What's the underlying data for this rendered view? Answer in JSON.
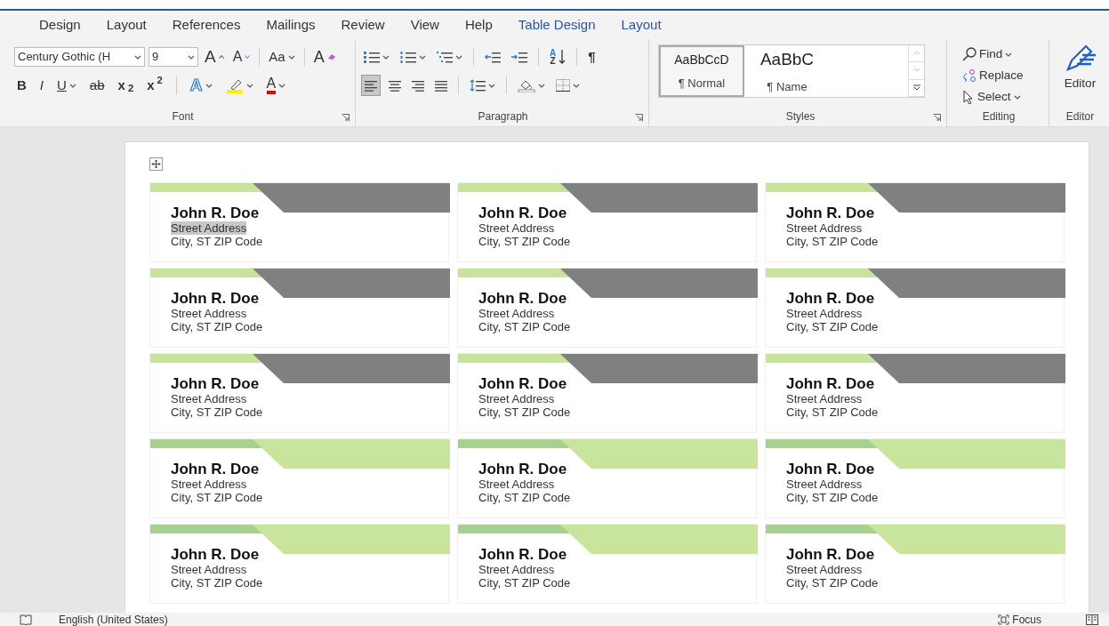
{
  "tabs": [
    {
      "label": "Design",
      "kind": "normal"
    },
    {
      "label": "Layout",
      "kind": "normal"
    },
    {
      "label": "References",
      "kind": "normal"
    },
    {
      "label": "Mailings",
      "kind": "normal"
    },
    {
      "label": "Review",
      "kind": "normal"
    },
    {
      "label": "View",
      "kind": "normal"
    },
    {
      "label": "Help",
      "kind": "normal"
    },
    {
      "label": "Table Design",
      "kind": "contextual"
    },
    {
      "label": "Layout",
      "kind": "contextual"
    }
  ],
  "font": {
    "label": "Font",
    "font_name": "Century Gothic (H",
    "font_size": "9",
    "grow": "A",
    "shrink": "A",
    "change_case": "Aa",
    "clear": "A",
    "format_buttons": [
      {
        "label": "B",
        "kind": "bold"
      },
      {
        "label": "I",
        "kind": "italic"
      },
      {
        "label": "U",
        "kind": "underline"
      },
      {
        "label": "ab",
        "kind": "strike"
      },
      {
        "label": "x$_{2}$",
        "kind": "script"
      },
      {
        "label": "x$^{2}$",
        "kind": "script"
      }
    ],
    "effects": "A",
    "font_color": "A"
  },
  "paragraph": {
    "label": "Paragraph",
    "sort_top": "A",
    "sort_bottom": "Z",
    "pilcrow": "¶",
    "alignments": [
      {
        "kind": "left",
        "selected": true
      },
      {
        "kind": "center",
        "selected": false
      },
      {
        "kind": "right",
        "selected": false
      },
      {
        "kind": "justify",
        "selected": false
      }
    ]
  },
  "styles": {
    "label": "Styles",
    "items": [
      {
        "preview": "AaBbCcD",
        "name": "¶ Normal",
        "selected": true
      },
      {
        "preview": "AaBbC",
        "name": "¶ Name",
        "selected": false
      }
    ]
  },
  "editing": {
    "label": "Editing",
    "find": "Find",
    "replace": "Replace",
    "select": "Select"
  },
  "editor": {
    "button": "Editor",
    "label": "Editor"
  },
  "labels": [
    {
      "name": "John R. Doe",
      "street": "Street Address",
      "city": "City, ST ZIP Code",
      "kind": "gray",
      "street_selected": true
    },
    {
      "name": "John R. Doe",
      "street": "Street Address",
      "city": "City, ST ZIP Code",
      "kind": "gray",
      "street_selected": false
    },
    {
      "name": "John R. Doe",
      "street": "Street Address",
      "city": "City, ST ZIP Code",
      "kind": "gray",
      "street_selected": false
    },
    {
      "name": "John R. Doe",
      "street": "Street Address",
      "city": "City, ST ZIP Code",
      "kind": "gray",
      "street_selected": false
    },
    {
      "name": "John R. Doe",
      "street": "Street Address",
      "city": "City, ST ZIP Code",
      "kind": "gray",
      "street_selected": false
    },
    {
      "name": "John R. Doe",
      "street": "Street Address",
      "city": "City, ST ZIP Code",
      "kind": "gray",
      "street_selected": false
    },
    {
      "name": "John R. Doe",
      "street": "Street Address",
      "city": "City, ST ZIP Code",
      "kind": "gray",
      "street_selected": false
    },
    {
      "name": "John R. Doe",
      "street": "Street Address",
      "city": "City, ST ZIP Code",
      "kind": "gray",
      "street_selected": false
    },
    {
      "name": "John R. Doe",
      "street": "Street Address",
      "city": "City, ST ZIP Code",
      "kind": "gray",
      "street_selected": false
    },
    {
      "name": "John R. Doe",
      "street": "Street Address",
      "city": "City, ST ZIP Code",
      "kind": "green",
      "street_selected": false
    },
    {
      "name": "John R. Doe",
      "street": "Street Address",
      "city": "City, ST ZIP Code",
      "kind": "green",
      "street_selected": false
    },
    {
      "name": "John R. Doe",
      "street": "Street Address",
      "city": "City, ST ZIP Code",
      "kind": "green",
      "street_selected": false
    },
    {
      "name": "John R. Doe",
      "street": "Street Address",
      "city": "City, ST ZIP Code",
      "kind": "green",
      "street_selected": false
    },
    {
      "name": "John R. Doe",
      "street": "Street Address",
      "city": "City, ST ZIP Code",
      "kind": "green",
      "street_selected": false
    },
    {
      "name": "John R. Doe",
      "street": "Street Address",
      "city": "City, ST ZIP Code",
      "kind": "green",
      "street_selected": false
    }
  ],
  "status_bar": {
    "language": "English (United States)",
    "focus": "Focus"
  }
}
